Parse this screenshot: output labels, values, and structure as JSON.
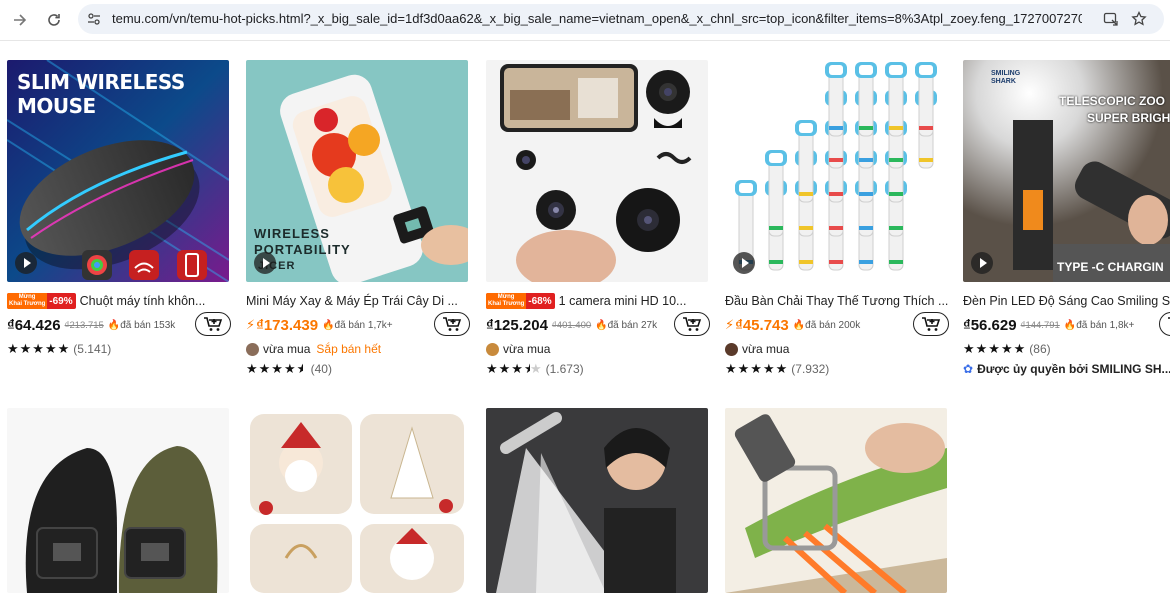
{
  "browser": {
    "url_host": "temu.com",
    "url_path": "/vn/temu-hot-picks.html?_x_big_sale_id=1df3d0aa62&_x_big_sale_name=vietnam_open&_x_chnl_src=top_icon&filter_items=8%3Atpl_zoey.feng_1727007270..."
  },
  "colors": {
    "accent": "#fb7701",
    "badge_red": "#e02020",
    "text": "#222222"
  },
  "products": [
    {
      "image_text": "SLIM WIRELESS MOUSE",
      "badge": {
        "tag_line1": "Mừng",
        "tag_line2": "Khai Trương",
        "discount": "-69%"
      },
      "title": "Chuột máy tính khôn...",
      "price": "₫64.426",
      "old_price": "₫213.715",
      "sold": "đã bán 153k",
      "rating_stars": 5,
      "rating_count": "(5.141)"
    },
    {
      "image_text_1": "WIRELESS",
      "image_text_2": "PORTABILITY",
      "image_text_3": "JICER",
      "title": "Mini Máy Xay & Máy Ép Trái Cây Di ...",
      "price": "₫173.439",
      "sold": "đã bán 1,7k+",
      "recent": "vừa mua",
      "stock_note": "Sắp bán hết",
      "rating_stars": 4.5,
      "rating_count": "(40)"
    },
    {
      "badge": {
        "tag_line1": "Mừng",
        "tag_line2": "Khai Trương",
        "discount": "-68%"
      },
      "title": "1 camera mini HD 10...",
      "price": "₫125.204",
      "old_price": "₫401.400",
      "sold": "đã bán 27k",
      "recent": "vừa mua",
      "rating_stars": 3.5,
      "rating_count": "(1.673)"
    },
    {
      "title": "Đầu Bàn Chải Thay Thế Tương Thích ...",
      "price": "₫45.743",
      "sold": "đã bán 200k",
      "recent": "vừa mua",
      "rating_stars": 5,
      "rating_count": "(7.932)"
    },
    {
      "image_text_1": "SMILING",
      "image_text_2": "SHARK",
      "image_text_3": "TELESCOPIC ZOO",
      "image_text_4": "SUPER BRIGH",
      "image_text_5": "TYPE -C CHARGIN",
      "title": "Đèn Pin LED Độ Sáng Cao Smiling S",
      "price": "₫56.629",
      "old_price": "₫144.791",
      "sold": "đã bán 1,8k+",
      "rating_stars": 5,
      "rating_count": "(86)",
      "authorized": "Được ủy quyền bởi SMILING SH..."
    }
  ],
  "stars": {
    "five": "★★★★★",
    "four_half": "★★★★",
    "three_half": "★★★"
  }
}
